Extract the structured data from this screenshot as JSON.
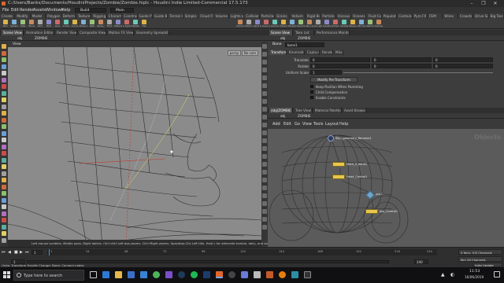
{
  "window": {
    "title": "C:/Users/Banks/Documents/HoudiniProjects/Zombie/Zombie.hiplc - Houdini Indie Limited-Commercial 17.5.173",
    "controls": [
      "–",
      "❐",
      "✕"
    ]
  },
  "menu": {
    "items": [
      "File",
      "Edit",
      "Render",
      "Assets",
      "Windows",
      "Help"
    ],
    "build_label": "Build",
    "main_label": "Main"
  },
  "shelf": {
    "tabs": [
      "Create",
      "Modify",
      "Model",
      "Polygon",
      "Deform",
      "Texture",
      "Rigging",
      "Characters",
      "Constraints",
      "Guide Pro...",
      "Guide Br...",
      "Terrain FX",
      "Simple FX",
      "Cloud FX",
      "Volume",
      "Lights and...",
      "Collisions",
      "Particles",
      "Grains",
      "Vellum",
      "Rigid Bodies",
      "Particle Fl...",
      "Viscous Fl...",
      "Oceans",
      "Fluid Con...",
      "Populate C...",
      "Container",
      "Pyro FX",
      "FEM",
      "Wires",
      "Crowds",
      "Drive Sim...",
      "Big Tools"
    ],
    "tools": [
      "Box",
      "Sphere",
      "Tube",
      "Torus",
      "Grid",
      "Null",
      "Line",
      "Circle",
      "Curve",
      "Draw Curve",
      "Path",
      "Spray Paint",
      "Font",
      "Platonic",
      "L-System",
      "Metaball",
      "File"
    ],
    "right_tools": [
      "Camera",
      "Point Light",
      "Spot Light",
      "Area Light",
      "Geometry Light",
      "Volume Light",
      "Distant Light",
      "Environment",
      "Sky Light",
      "GI Light",
      "Caustic Light",
      "Portal Light",
      "Ambient Light",
      "Stereo Camera",
      "VR Camera",
      "Switcher",
      "Gamepad Camera"
    ]
  },
  "left_panes": {
    "tabs": [
      "Scene View",
      "Animation Editor",
      "Render View",
      "Composite View",
      "Motion FX View",
      "Geometry Spreadsheet"
    ],
    "path": [
      "obj",
      "ZOMBIE"
    ],
    "view_label": "View",
    "persp_label": "persp",
    "cam_label": "No cam",
    "hint": "Left mouse tumbles. Middle pans. Right dollies. Ctrl+Alt+Left box-zooms. Ctrl+Right zooms. Spacebar-Ctrl-Left tilts. Hold L for alternate tumble, dolly, and zoom."
  },
  "params": {
    "tabs": [
      "Scene View",
      "Take List",
      "Performance Monitor"
    ],
    "path": [
      "obj",
      "ZOMBIE"
    ],
    "node_type": "Bone",
    "node_name": "bone1",
    "subtabs": [
      "Transform",
      "Kinematics",
      "Capture",
      "Render",
      "Misc"
    ],
    "rows": [
      {
        "label": "Translate",
        "values": [
          "0",
          "0",
          "0"
        ]
      },
      {
        "label": "Rotate",
        "values": [
          "0",
          "0",
          "0"
        ]
      },
      {
        "label": "Uniform Scale",
        "values": [
          "1"
        ]
      }
    ],
    "modify_button": "Modify Pre-Transform",
    "checks": [
      "Keep Position When Parenting",
      "Child Compensation",
      "Enable Constraints"
    ]
  },
  "network": {
    "tabs": [
      "/obj/ZOMBIE",
      "Tree View",
      "Material Palette",
      "Asset Browser"
    ],
    "path": [
      "obj",
      "ZOMBIE"
    ],
    "menu": [
      "Add",
      "Edit",
      "Go",
      "View",
      "Tools",
      "Layout",
      "Help"
    ],
    "watermark": "Objects",
    "nodes": [
      {
        "name": "Skin_geometry_Rename1"
      },
      {
        "name": "Neck_2_bone1"
      },
      {
        "name": "Head_Control1"
      },
      {
        "name": "jaw1"
      },
      {
        "name": "jaw_Control1"
      }
    ]
  },
  "timeline": {
    "frame": "1",
    "ticks": [
      "1",
      "24",
      "48",
      "72",
      "96",
      "120",
      "144",
      "168",
      "192",
      "216",
      "240"
    ],
    "start": "1",
    "end": "240",
    "right_buttons": [
      "0 Keys, 0/0 Channels",
      "Key All Channels",
      "Auto Update"
    ]
  },
  "status": {
    "text": "Undo: Transform Handle Change: Bone: Connect nodes"
  },
  "taskbar": {
    "search_placeholder": "Type here to search",
    "time": "11:53",
    "date": "16/06/2019"
  }
}
